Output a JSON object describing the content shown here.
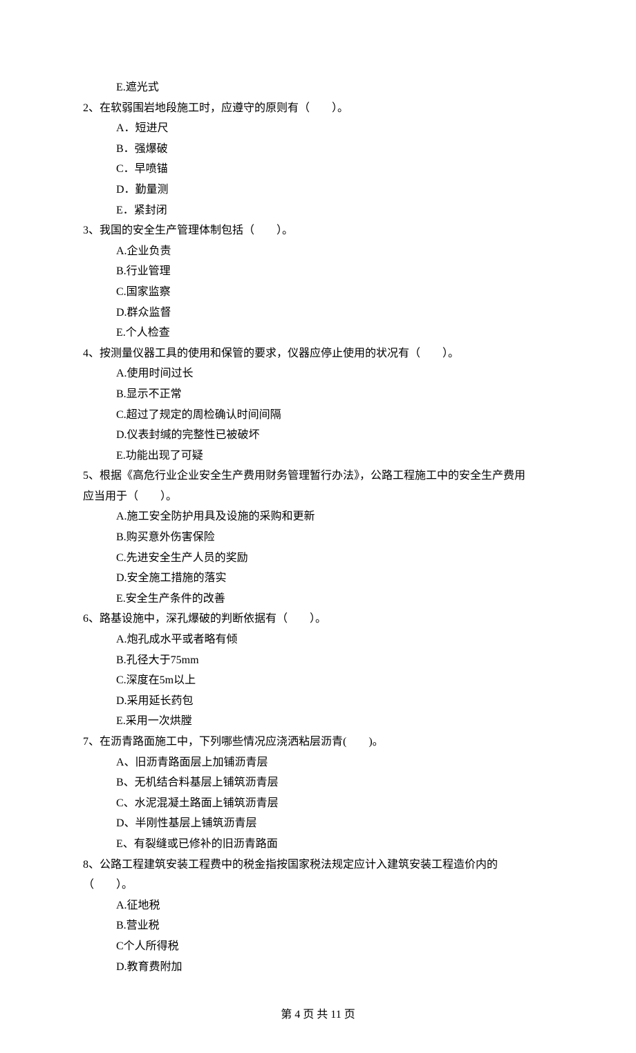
{
  "prelude": {
    "option_e": "E.遮光式"
  },
  "q2": {
    "stem": "2、在软弱围岩地段施工时，应遵守的原则有（　　）。",
    "a": "A．短进尺",
    "b": "B．强爆破",
    "c": "C．早喷锚",
    "d": "D．勤量测",
    "e": "E．紧封闭"
  },
  "q3": {
    "stem": "3、我国的安全生产管理体制包括（　　）。",
    "a": "A.企业负责",
    "b": "B.行业管理",
    "c": "C.国家监察",
    "d": "D.群众监督",
    "e": "E.个人检查"
  },
  "q4": {
    "stem": "4、按测量仪器工具的使用和保管的要求，仪器应停止使用的状况有（　　）。",
    "a": "A.使用时间过长",
    "b": "B.显示不正常",
    "c": "C.超过了规定的周检确认时间间隔",
    "d": "D.仪表封缄的完整性已被破坏",
    "e": "E.功能出现了可疑"
  },
  "q5": {
    "stem_line1": "5、根据《高危行业企业安全生产费用财务管理暂行办法》，公路工程施工中的安全生产费用",
    "stem_line2": "应当用于（　　）。",
    "a": "A.施工安全防护用具及设施的采购和更新",
    "b": "B.购买意外伤害保险",
    "c": "C.先进安全生产人员的奖励",
    "d": "D.安全施工措施的落实",
    "e": "E.安全生产条件的改善"
  },
  "q6": {
    "stem": "6、路基设施中，深孔爆破的判断依据有（　　）。",
    "a": "A.炮孔成水平或者略有倾",
    "b": "B.孔径大于75mm",
    "c": "C.深度在5m以上",
    "d": "D.采用延长药包",
    "e": "E.采用一次烘膛"
  },
  "q7": {
    "stem": "7、在沥青路面施工中，下列哪些情况应浇洒粘层沥青(　　)。",
    "a": "A、旧沥青路面层上加铺沥青层",
    "b": "B、无机结合料基层上铺筑沥青层",
    "c": "C、水泥混凝土路面上铺筑沥青层",
    "d": "D、半刚性基层上铺筑沥青层",
    "e": "E、有裂缝或已修补的旧沥青路面"
  },
  "q8": {
    "stem_line1": "8、公路工程建筑安装工程费中的税金指按国家税法规定应计入建筑安装工程造价内的",
    "stem_line2": "（　　）。",
    "a": "A.征地税",
    "b": "B.营业税",
    "c": "C个人所得税",
    "d": "D.教育费附加"
  },
  "footer": "第 4 页 共 11 页"
}
